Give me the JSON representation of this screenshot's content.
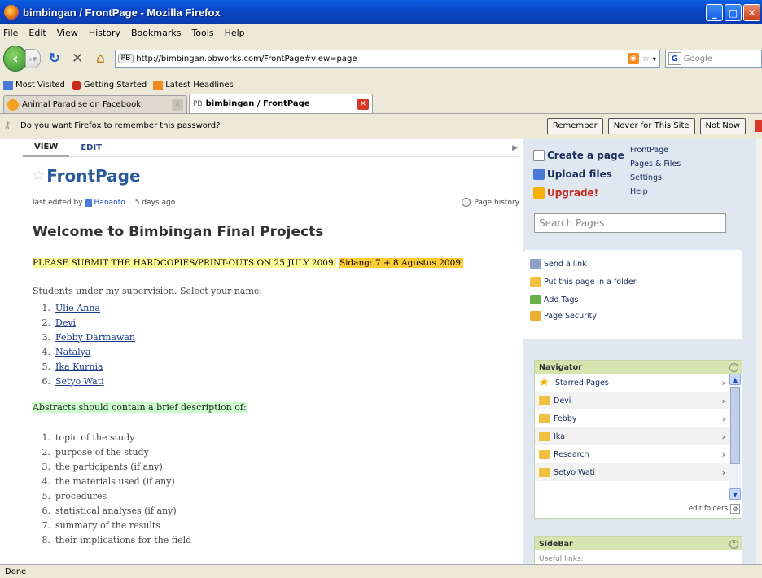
{
  "window": {
    "title": "bimbingan / FrontPage - Mozilla Firefox"
  },
  "menu": [
    "File",
    "Edit",
    "View",
    "History",
    "Bookmarks",
    "Tools",
    "Help"
  ],
  "nav": {
    "url": "http://bimbingan.pbworks.com/FrontPage#view=page",
    "site_badge": "PB",
    "search_placeholder": "Google"
  },
  "bookmarks": [
    "Most Visited",
    "Getting Started",
    "Latest Headlines"
  ],
  "tabs": [
    {
      "label": "Animal Paradise on Facebook",
      "active": false
    },
    {
      "label": "bimbingan / FrontPage",
      "badge": "PB",
      "active": true
    }
  ],
  "notification": {
    "text": "Do you want Firefox to remember this password?",
    "remember": "Remember",
    "never": "Never for This Site",
    "not_now": "Not Now"
  },
  "page": {
    "view_tab": "VIEW",
    "edit_tab": "EDIT",
    "title": "FrontPage",
    "edited_by": "last edited by",
    "user": "Hananto",
    "when": "5 days ago",
    "history": "Page history",
    "heading": "Welcome to Bimbingan Final Projects",
    "notice": "PLEASE SUBMIT THE HARDCOPIES/PRINT-OUTS ON 25 JULY 2009.",
    "sidang": "Sidang: 7 + 8 Agustus 2009.",
    "intro": "Students under my supervision. Select your name:",
    "students": [
      "Ulie Anna",
      "Devi",
      "Febby Darmawan",
      "Natalya",
      "Ika Kurnia",
      "Setyo Wati"
    ],
    "abstract_intro": "Abstracts should contain a brief description of:",
    "abstract_items": [
      "topic of the study",
      "purpose of the study",
      "the participants (if any)",
      "the materials used (if any)",
      "procedures",
      "statistical analyses (if any)",
      "summary of the results",
      "their implications for the field"
    ]
  },
  "side": {
    "actions": [
      "Create a page",
      "Upload files",
      "Upgrade!"
    ],
    "links": [
      "FrontPage",
      "Pages & Files",
      "Settings",
      "Help"
    ],
    "search_placeholder": "Search Pages",
    "tools": [
      "Send a link",
      "Put this page in a folder",
      "Add Tags",
      "Page Security"
    ],
    "navigator": {
      "title": "Navigator",
      "items": [
        "Starred Pages",
        "Devi",
        "Febby",
        "Ika",
        "Research",
        "Setyo Wati"
      ],
      "edit": "edit folders"
    },
    "sidebar": {
      "title": "SideBar",
      "text": "Useful links:"
    }
  },
  "status": "Done",
  "colors": {
    "titlebar": "#0a46c8",
    "highlight_yellow": "#ffff99",
    "highlight_orange": "#ffcc33",
    "highlight_green": "#ccffcc",
    "link": "#1a3a8a"
  }
}
